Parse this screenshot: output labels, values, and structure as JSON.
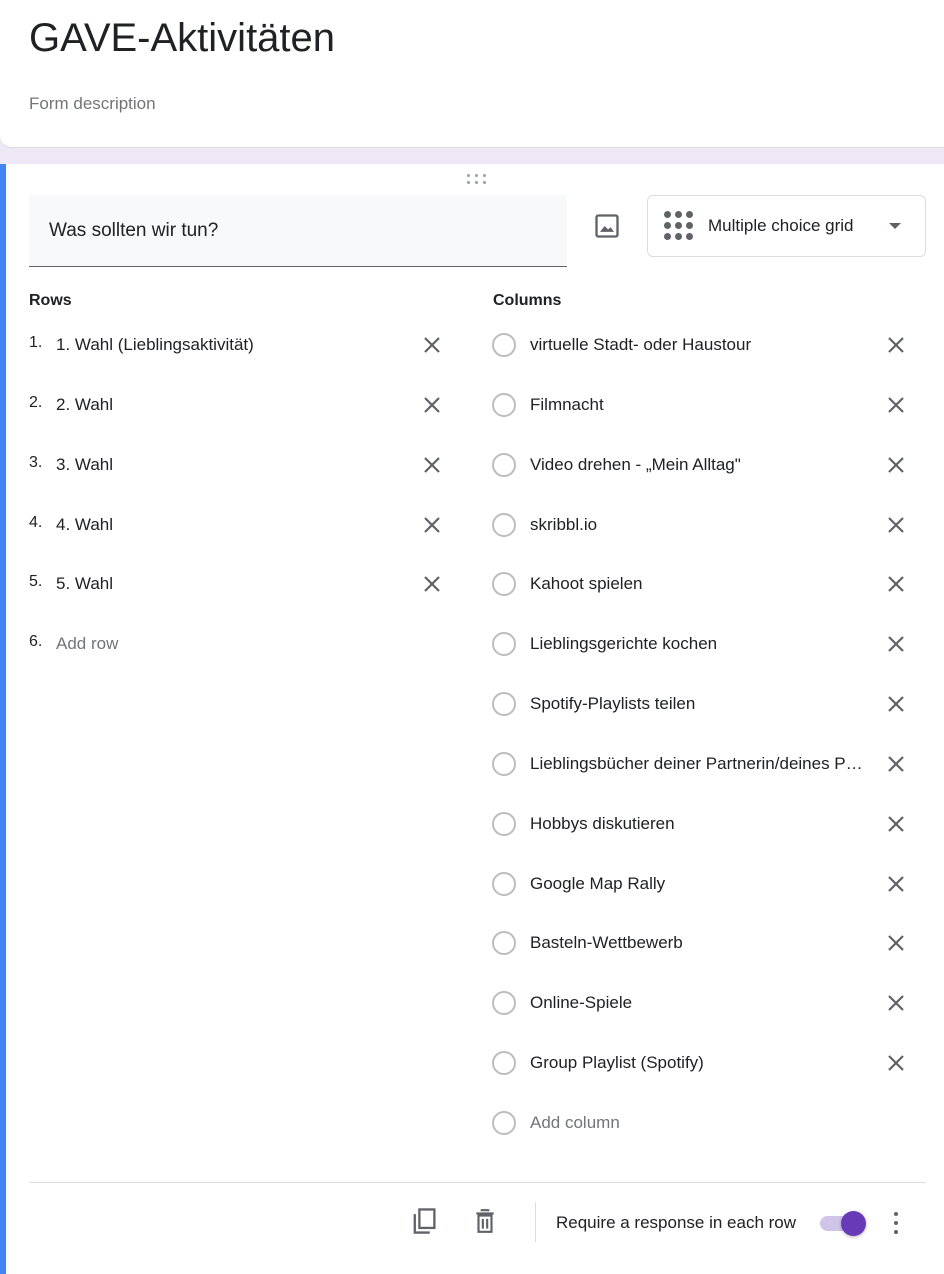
{
  "form": {
    "title": "GAVE-Aktivitäten",
    "description_placeholder": "Form description"
  },
  "question": {
    "title": "Was sollten wir tun?",
    "type_label": "Multiple choice grid",
    "rows_heading": "Rows",
    "columns_heading": "Columns",
    "rows": [
      {
        "num": "1.",
        "label": "1. Wahl (Lieblingsaktivität)"
      },
      {
        "num": "2.",
        "label": "2. Wahl"
      },
      {
        "num": "3.",
        "label": "3. Wahl"
      },
      {
        "num": "4.",
        "label": "4. Wahl"
      },
      {
        "num": "5.",
        "label": "5. Wahl"
      }
    ],
    "add_row": {
      "num": "6.",
      "label": "Add row"
    },
    "columns": [
      "virtuelle Stadt- oder Haustour",
      "Filmnacht",
      "Video drehen - „Mein Alltag\"",
      "skribbl.io",
      "Kahoot spielen",
      "Lieblingsgerichte kochen",
      "Spotify-Playlists teilen",
      "Lieblingsbücher deiner Partnerin/deines Partners lesen",
      "Hobbys diskutieren",
      "Google Map Rally",
      "Basteln-Wettbewerb",
      "Online-Spiele",
      "Group Playlist (Spotify)"
    ],
    "add_column": "Add column"
  },
  "footer": {
    "require_label": "Require a response in each row",
    "require_on": true
  },
  "colors": {
    "accent": "#4285f4",
    "toggle": "#673ab7",
    "background": "#ede7f6"
  }
}
